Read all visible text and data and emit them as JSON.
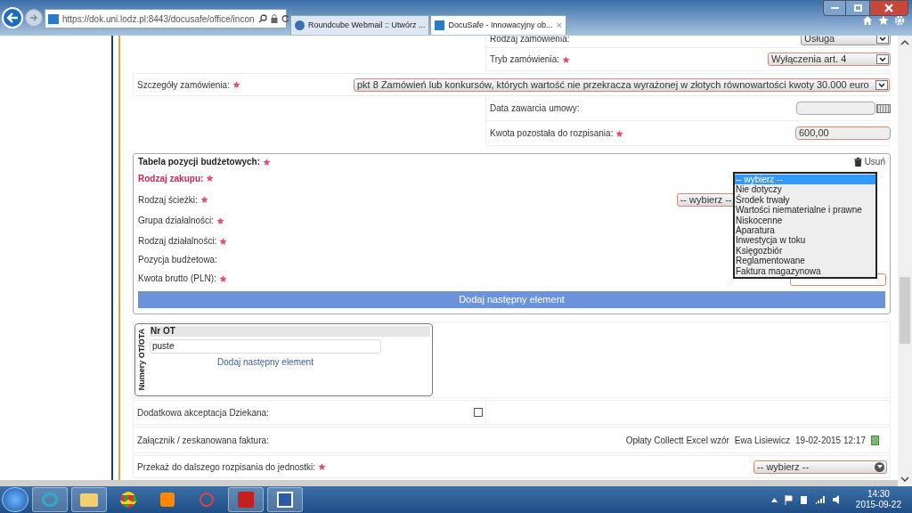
{
  "browser": {
    "address": "https://dok.uni.lodz.pl:8443/docusafe/office/incon",
    "tabs": [
      {
        "label": "Roundcube Webmail :: Utwórz ...",
        "selected": false
      },
      {
        "label": "DocuSafe - Innowacyjny ob...",
        "selected": true,
        "close": "×"
      }
    ]
  },
  "order_fields": [
    {
      "label": "Rodzaj zamówienia:",
      "required": false,
      "value": "Usługa"
    },
    {
      "label": "Tryb zamówienia:",
      "required": true,
      "value": "Wyłączenia art. 4"
    }
  ],
  "details": {
    "label": "Szczegóły zamówienia:",
    "required": true,
    "value": "pkt 8 Zamówień lub konkursów, których wartość nie przekracza wyrażonej w złotych równowartości kwoty 30.000 euro"
  },
  "contract_date": {
    "label": "Data zawarcia umowy:",
    "required": false
  },
  "remaining": {
    "label": "Kwota pozostała do rozpisania:",
    "required": true,
    "value": "600,00"
  },
  "budget_table": {
    "title": "Tabela pozycji budżetowych:",
    "remove": "Usuń",
    "fields": [
      {
        "label": "Rodzaj zakupu:",
        "required": true,
        "highlighted": true
      },
      {
        "label": "Rodzaj ścieżki:",
        "required": true,
        "highlighted": false
      },
      {
        "label": "Grupa działalności:",
        "required": true,
        "highlighted": false
      },
      {
        "label": "Rodzaj działalności:",
        "required": true,
        "highlighted": false
      },
      {
        "label": "Pozycja budżetowa:",
        "required": false,
        "highlighted": false
      },
      {
        "label": "Kwota brutto (PLN):",
        "required": true,
        "highlighted": false
      }
    ],
    "path_select": "-- wybierz --",
    "options": [
      {
        "label": "-- wybierz --",
        "selected": true
      },
      {
        "label": "Nie dotyczy",
        "selected": false
      },
      {
        "label": "Środek trwały",
        "selected": false
      },
      {
        "label": "Wartości niematerialne i prawne",
        "selected": false
      },
      {
        "label": "Niskocenne",
        "selected": false
      },
      {
        "label": "Aparatura",
        "selected": false
      },
      {
        "label": "Inwestycja w toku",
        "selected": false
      },
      {
        "label": "Księgozbiór",
        "selected": false
      },
      {
        "label": "Reglamentowane",
        "selected": false
      },
      {
        "label": "Faktura magazynowa",
        "selected": false
      }
    ],
    "add_button": "Dodaj następny element"
  },
  "ot_box": {
    "title": "Numery OT/OTA",
    "column": "Nr OT",
    "value": "puste",
    "add_link": "Dodaj następny element"
  },
  "dean": {
    "label": "Dodatkowa akceptacja Dziekana:",
    "checked": false
  },
  "attachment": {
    "label": "Załącznik / zeskanowana faktura:",
    "file": "Opłaty Collectt Excel wzór",
    "author": "Ewa Lisiewicz",
    "date": "19-02-2015 12:17"
  },
  "transfer": {
    "label": "Przekaż do dalszego rozpisania do jednostki:",
    "required": true,
    "value": "-- wybierz --"
  },
  "taskbar": {
    "time": "14:30",
    "date": "2015-09-22"
  }
}
